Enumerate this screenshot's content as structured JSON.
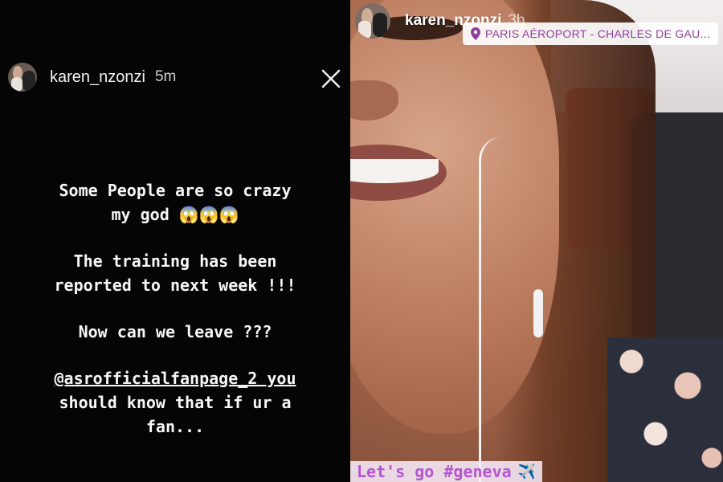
{
  "left_story": {
    "username": "karen_nzonzi",
    "time": "5m",
    "lines": [
      "Some People are so crazy",
      "my god 😱😱😱",
      "",
      "The training has been",
      "reported to next week !!!",
      "",
      "Now can we leave ???",
      "",
      "@asrofficialfanpage_2 you",
      "should know that if ur a",
      "fan..."
    ]
  },
  "right_story": {
    "username": "karen_nzonzi",
    "time": "3h",
    "location": "PARIS AÉROPORT - CHARLES DE GAU...",
    "caption": "Let's go #geneva",
    "plane_emoji": "✈️"
  },
  "colors": {
    "location_text": "#8d3f9b",
    "caption_text": "#b455d0",
    "caption_bg": "#f6ebff"
  },
  "icons": {
    "close": "close-icon",
    "location": "location-pin-icon",
    "plane": "airplane-icon"
  }
}
